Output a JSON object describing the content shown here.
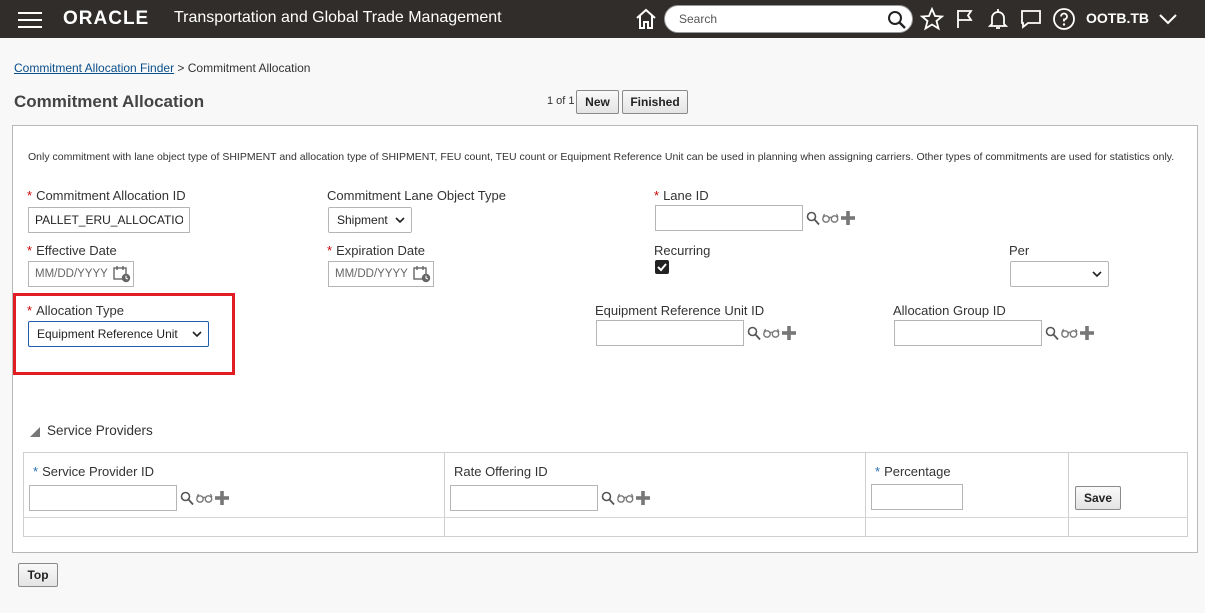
{
  "header": {
    "brand": "ORACLE",
    "app_title": "Transportation and Global Trade Management",
    "search_placeholder": "Search",
    "user": "OOTB.TB"
  },
  "breadcrumb": {
    "parent": "Commitment Allocation Finder",
    "separator": ">",
    "current": "Commitment Allocation"
  },
  "page": {
    "title": "Commitment Allocation",
    "pager": "1 of 1",
    "new_label": "New",
    "finished_label": "Finished",
    "top_label": "Top"
  },
  "form": {
    "info": "Only commitment with lane object type of SHIPMENT and allocation type of SHIPMENT, FEU count, TEU count or Equipment Reference Unit can be used in planning when assigning carriers. Other types of commitments are used for statistics only.",
    "required_mark": "*",
    "commitment_allocation_id": {
      "label": "Commitment Allocation ID",
      "value": "PALLET_ERU_ALLOCATION"
    },
    "lane_object_type": {
      "label": "Commitment Lane Object Type",
      "value": "Shipment"
    },
    "lane_id": {
      "label": "Lane ID",
      "value": ""
    },
    "effective_date": {
      "label": "Effective Date",
      "placeholder": "MM/DD/YYYY"
    },
    "expiration_date": {
      "label": "Expiration Date",
      "placeholder": "MM/DD/YYYY"
    },
    "recurring": {
      "label": "Recurring",
      "checked": true
    },
    "per": {
      "label": "Per",
      "value": ""
    },
    "allocation_type": {
      "label": "Allocation Type",
      "value": "Equipment Reference Unit"
    },
    "equipment_reference_unit_id": {
      "label": "Equipment Reference Unit ID",
      "value": ""
    },
    "allocation_group_id": {
      "label": "Allocation Group ID",
      "value": ""
    }
  },
  "service_providers": {
    "title": "Service Providers",
    "columns": {
      "service_provider_id": "Service Provider ID",
      "rate_offering_id": "Rate Offering ID",
      "percentage": "Percentage"
    },
    "save_label": "Save"
  },
  "colors": {
    "header_bg": "#312d2a",
    "link": "#0b4f8a",
    "required": "#cc0000",
    "highlight": "#e31b23"
  }
}
